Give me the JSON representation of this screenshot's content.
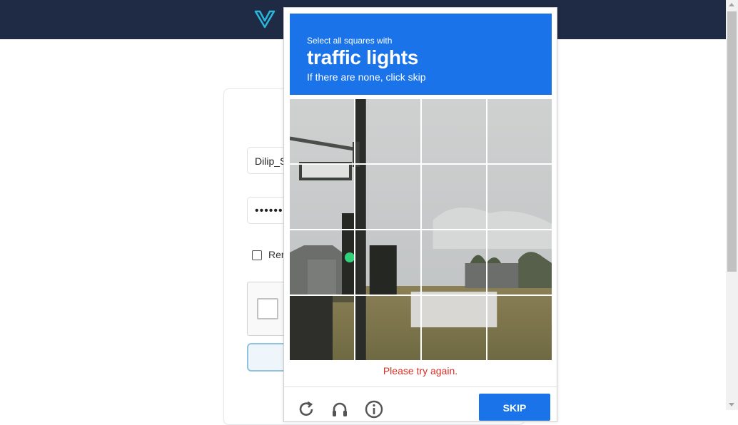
{
  "header": {
    "logo_icon": "v-logo-icon"
  },
  "login": {
    "username_value": "Dilip_S",
    "password_value": "••••••••",
    "remember_label": "Rer"
  },
  "captcha": {
    "prompt_line1": "Select all squares with",
    "prompt_keyword": "traffic lights",
    "prompt_line3": "If there are none, click skip",
    "error_text": "Please try again.",
    "skip_label": "SKIP",
    "footer_icons": [
      "reload-icon",
      "audio-icon",
      "info-icon"
    ],
    "grid_rows": 4,
    "grid_cols": 4
  },
  "colors": {
    "header_bg": "#1f2a44",
    "accent_blue": "#1a73e8",
    "error_red": "#d93025"
  }
}
